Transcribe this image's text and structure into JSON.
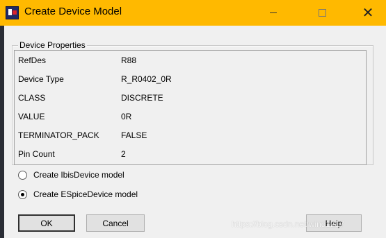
{
  "window": {
    "title": "Create Device Model",
    "accent_color": "#ffb900"
  },
  "title_buttons": {
    "minimize_icon": "minimize-icon",
    "maximize_icon": "maximize-icon",
    "close_icon": "close-icon",
    "close_glyph": "✕"
  },
  "group": {
    "legend": "Device Properties"
  },
  "properties": [
    {
      "label": "RefDes",
      "value": "R88"
    },
    {
      "label": "Device Type",
      "value": "R_R0402_0R"
    },
    {
      "label": "CLASS",
      "value": "DISCRETE"
    },
    {
      "label": "VALUE",
      "value": "0R"
    },
    {
      "label": "TERMINATOR_PACK",
      "value": "FALSE"
    },
    {
      "label": "Pin Count",
      "value": "2"
    }
  ],
  "options": [
    {
      "label": "Create IbisDevice model",
      "checked": false
    },
    {
      "label": "Create ESpiceDevice model",
      "checked": true
    }
  ],
  "buttons": {
    "ok": "OK",
    "cancel": "Cancel",
    "help": "Help"
  },
  "watermark": "https://blog.csdn.net/wind1217"
}
